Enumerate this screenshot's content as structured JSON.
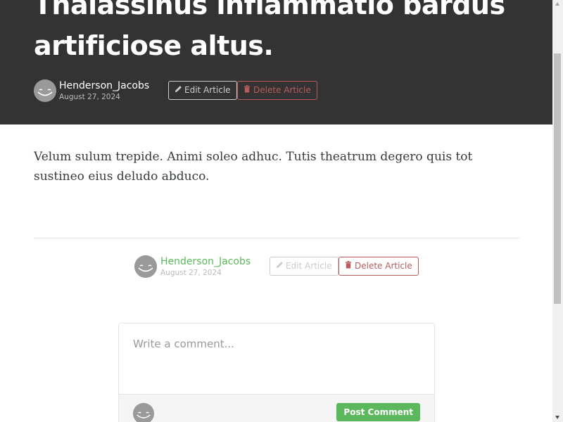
{
  "article": {
    "title": "Thalassinus inflammatio bardus artificiose altus.",
    "body": "Velum sulum trepide. Animi soleo adhuc. Tutis theatrum degero quis tot sustineo eius deludo abduco.",
    "author": "Henderson_Jacobs",
    "date": "August 27, 2024"
  },
  "actions": {
    "edit_label": "Edit Article",
    "delete_label": "Delete Article",
    "edit_icon": "pencil-icon",
    "delete_icon": "trash-icon"
  },
  "comment_form": {
    "placeholder": "Write a comment...",
    "submit_label": "Post Comment"
  },
  "colors": {
    "banner": "#333333",
    "accent": "#5cb85c",
    "danger": "#b85c5c"
  }
}
